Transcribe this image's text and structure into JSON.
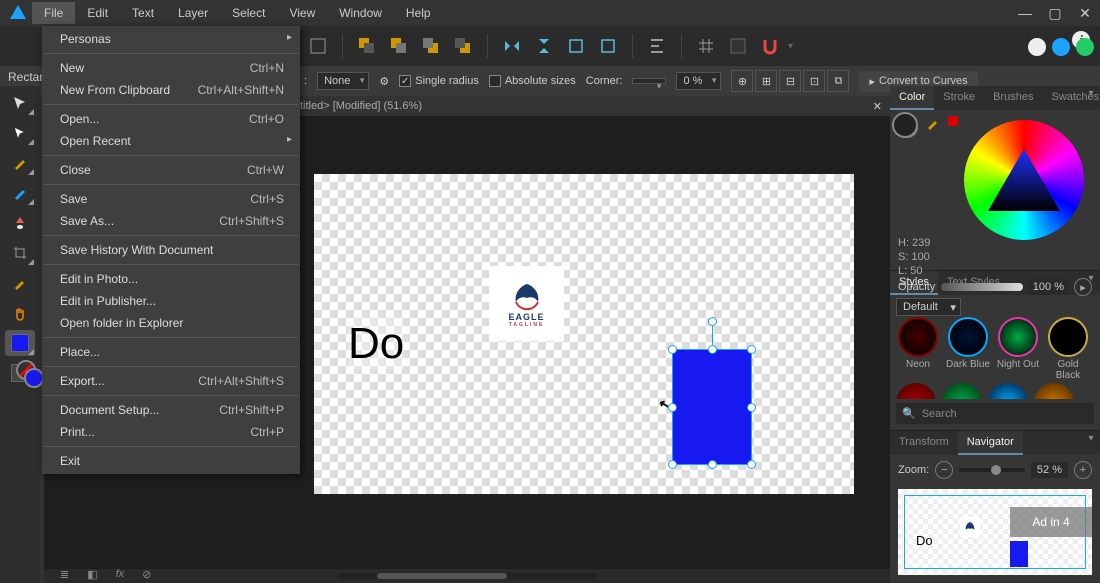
{
  "menu": {
    "items": [
      "File",
      "Edit",
      "Text",
      "Layer",
      "Select",
      "View",
      "Window",
      "Help"
    ],
    "active": 0
  },
  "file_menu": [
    {
      "label": "Personas",
      "arrow": true
    },
    {
      "sep": true
    },
    {
      "label": "New",
      "short": "Ctrl+N"
    },
    {
      "label": "New From Clipboard",
      "short": "Ctrl+Alt+Shift+N"
    },
    {
      "sep": true
    },
    {
      "label": "Open...",
      "short": "Ctrl+O"
    },
    {
      "label": "Open Recent",
      "arrow": true
    },
    {
      "sep": true
    },
    {
      "label": "Close",
      "short": "Ctrl+W"
    },
    {
      "sep": true
    },
    {
      "label": "Save",
      "short": "Ctrl+S"
    },
    {
      "label": "Save As...",
      "short": "Ctrl+Shift+S"
    },
    {
      "sep": true
    },
    {
      "label": "Save History With Document"
    },
    {
      "sep": true
    },
    {
      "label": "Edit in Photo..."
    },
    {
      "label": "Edit in Publisher..."
    },
    {
      "label": "Open folder in Explorer"
    },
    {
      "sep": true
    },
    {
      "label": "Place..."
    },
    {
      "sep": true
    },
    {
      "label": "Export...",
      "short": "Ctrl+Alt+Shift+S"
    },
    {
      "sep": true
    },
    {
      "label": "Document Setup...",
      "short": "Ctrl+Shift+P"
    },
    {
      "label": "Print...",
      "short": "Ctrl+P"
    },
    {
      "sep": true
    },
    {
      "label": "Exit"
    }
  ],
  "tool_label": "Rectan",
  "context": {
    "none": "None",
    "single_radius": "Single radius",
    "absolute": "Absolute sizes",
    "corner_label": "Corner:",
    "corner_pct": "0 %",
    "convert": "Convert to Curves"
  },
  "tab_title": "titled> [Modified] (51.6%)",
  "canvas": {
    "text": "Do",
    "logo_text": "EAGLE",
    "logo_tag": "TAGLINE"
  },
  "color": {
    "tabs": [
      "Color",
      "Stroke",
      "Brushes",
      "Swatches"
    ],
    "h": "H: 239",
    "s": "S: 100",
    "l": "L: 50",
    "opacity_label": "Opacity",
    "opacity_value": "100 %"
  },
  "styles": {
    "tabs": [
      "Styles",
      "Text Styles"
    ],
    "preset": "Default",
    "items": [
      "Neon",
      "Dark Blue",
      "Night Out",
      "Gold Black"
    ],
    "search_ph": "Search"
  },
  "nav": {
    "tabs": [
      "Transform",
      "Navigator"
    ],
    "zoom_label": "Zoom:",
    "zoom_value": "52 %",
    "preview_text": "Do",
    "ad": "Ad in 4"
  }
}
